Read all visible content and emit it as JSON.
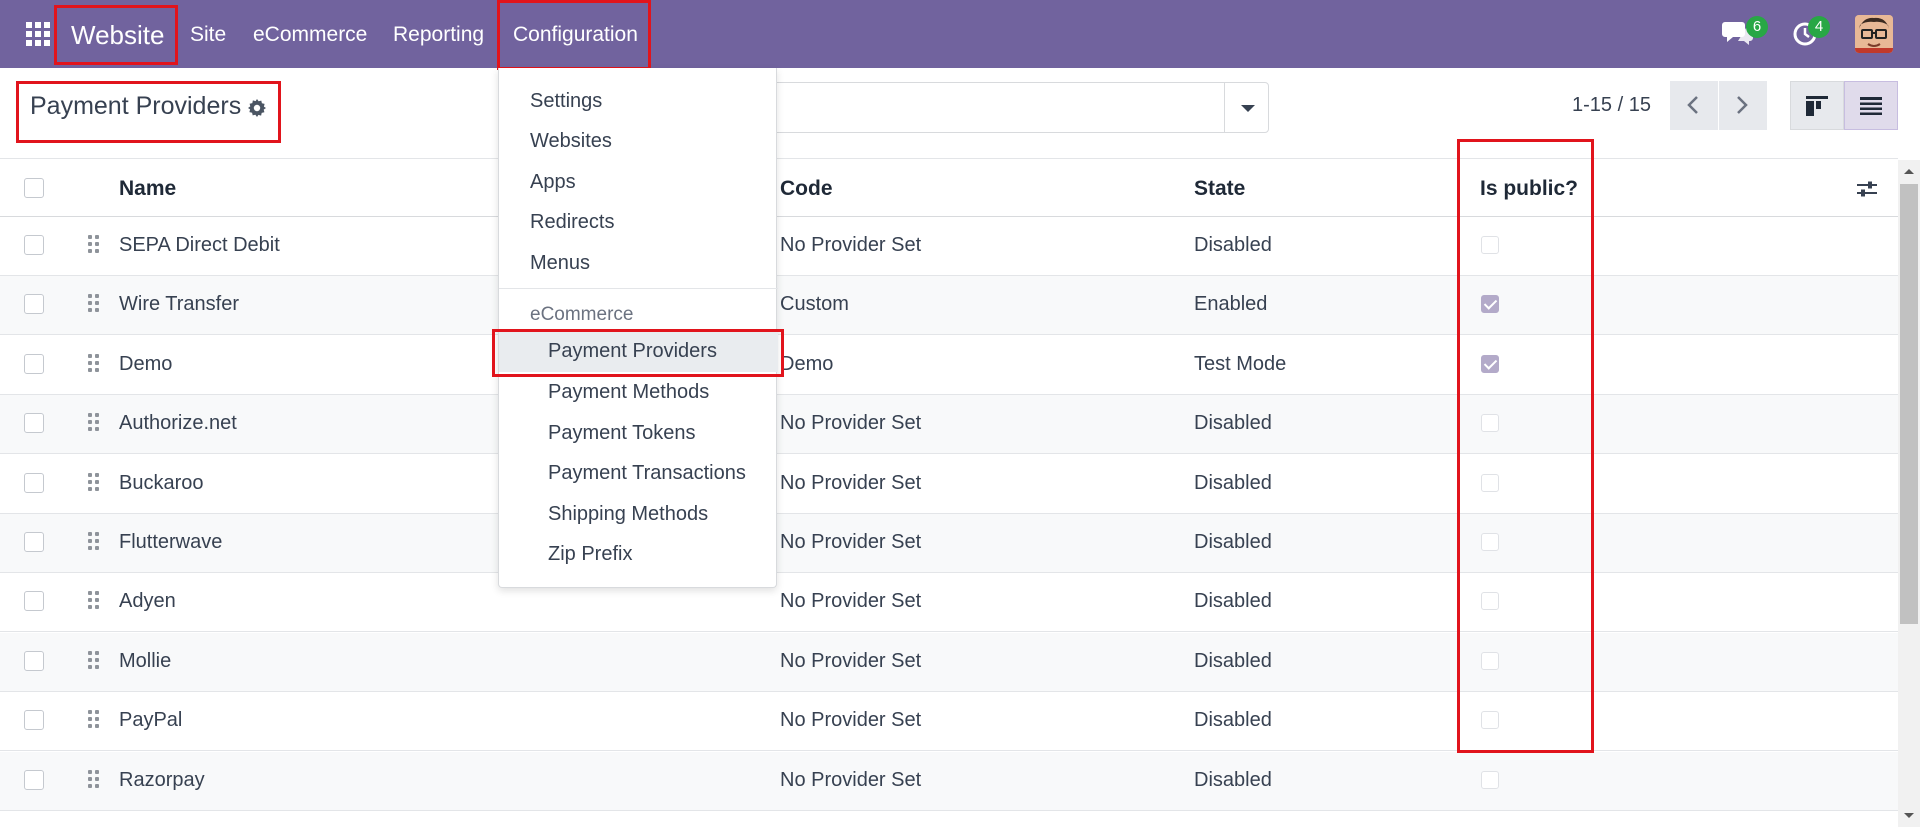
{
  "navbar": {
    "brand": "Website",
    "menu": [
      "Site",
      "eCommerce",
      "Reporting",
      "Configuration"
    ],
    "messages_count": "6",
    "activities_count": "4"
  },
  "control_panel": {
    "title": "Payment Providers",
    "pager": "1-15 / 15"
  },
  "table": {
    "columns": [
      "Name",
      "Code",
      "State",
      "Is public?"
    ],
    "rows": [
      {
        "name": "SEPA Direct Debit",
        "code": "No Provider Set",
        "state": "Disabled",
        "is_public": false
      },
      {
        "name": "Wire Transfer",
        "code": "Custom",
        "state": "Enabled",
        "is_public": true
      },
      {
        "name": "Demo",
        "code": "Demo",
        "state": "Test Mode",
        "is_public": true
      },
      {
        "name": "Authorize.net",
        "code": "No Provider Set",
        "state": "Disabled",
        "is_public": false
      },
      {
        "name": "Buckaroo",
        "code": "No Provider Set",
        "state": "Disabled",
        "is_public": false
      },
      {
        "name": "Flutterwave",
        "code": "No Provider Set",
        "state": "Disabled",
        "is_public": false
      },
      {
        "name": "Adyen",
        "code": "No Provider Set",
        "state": "Disabled",
        "is_public": false
      },
      {
        "name": "Mollie",
        "code": "No Provider Set",
        "state": "Disabled",
        "is_public": false
      },
      {
        "name": "PayPal",
        "code": "No Provider Set",
        "state": "Disabled",
        "is_public": false
      },
      {
        "name": "Razorpay",
        "code": "No Provider Set",
        "state": "Disabled",
        "is_public": false
      }
    ]
  },
  "dropdown": {
    "items": [
      "Settings",
      "Websites",
      "Apps",
      "Redirects",
      "Menus"
    ],
    "section_header": "eCommerce",
    "section_items": [
      "Payment Providers",
      "Payment Methods",
      "Payment Tokens",
      "Payment Transactions",
      "Shipping Methods",
      "Zip Prefix"
    ]
  },
  "colors": {
    "navbar": "#71639e",
    "highlight": "#e1141c",
    "badge": "#28a745"
  }
}
